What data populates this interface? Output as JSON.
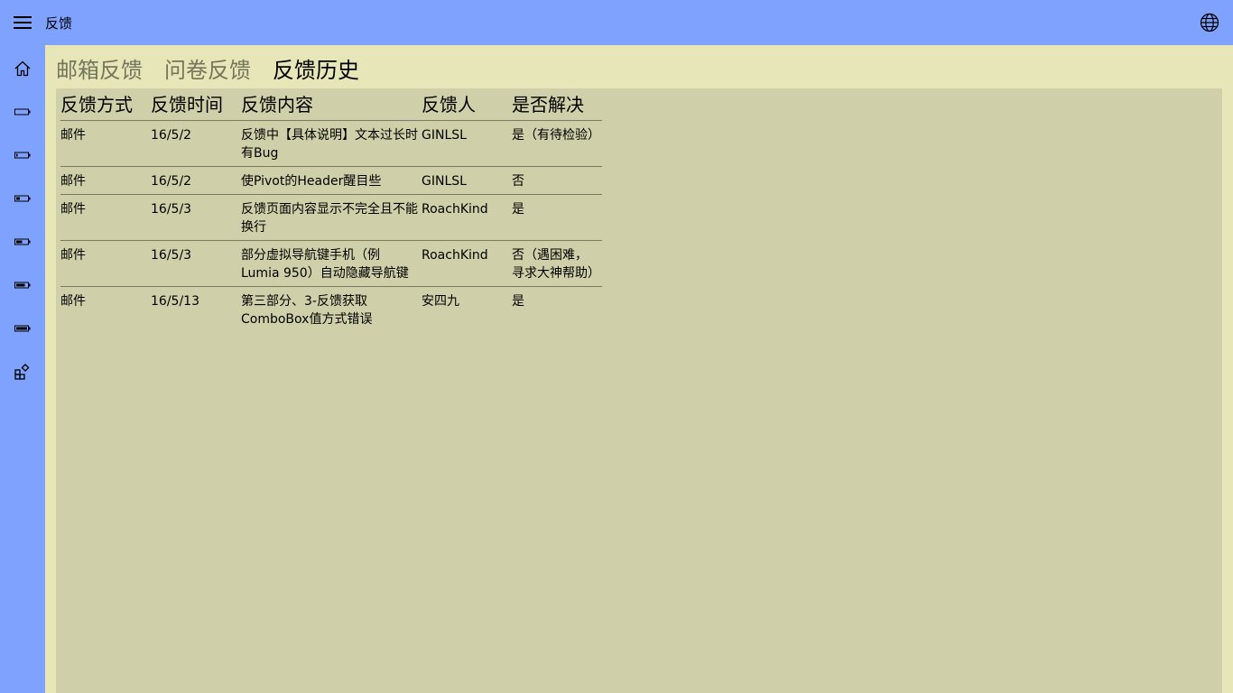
{
  "app": {
    "title": "反馈"
  },
  "colors": {
    "accent": "#7ea2fe",
    "content_bg": "#e6e6b8",
    "panel_bg": "#cfcfa9"
  },
  "sidebar": {
    "items": [
      {
        "icon": "home-icon"
      },
      {
        "icon": "battery-empty-icon"
      },
      {
        "icon": "battery-low-icon"
      },
      {
        "icon": "battery-quarter-icon"
      },
      {
        "icon": "battery-half-icon"
      },
      {
        "icon": "battery-high-icon"
      },
      {
        "icon": "battery-full-icon"
      },
      {
        "icon": "apps-add-icon"
      }
    ]
  },
  "pivot": {
    "tabs": [
      {
        "label": "邮箱反馈"
      },
      {
        "label": "问卷反馈"
      },
      {
        "label": "反馈历史"
      }
    ],
    "selected": "反馈历史"
  },
  "table": {
    "headers": [
      "反馈方式",
      "反馈时间",
      "反馈内容",
      "反馈人",
      "是否解决"
    ],
    "rows": [
      [
        "邮件",
        "16/5/2",
        "反馈中【具体说明】文本过长时有Bug",
        "GINLSL",
        "是（有待检验）"
      ],
      [
        "邮件",
        "16/5/2",
        "使Pivot的Header醒目些",
        "GINLSL",
        "否"
      ],
      [
        "邮件",
        "16/5/3",
        "反馈页面内容显示不完全且不能换行",
        "RoachKind",
        "是"
      ],
      [
        "邮件",
        "16/5/3",
        "部分虚拟导航键手机（例Lumia 950）自动隐藏导航键",
        "RoachKind",
        "否（遇困难，寻求大神帮助）"
      ],
      [
        "邮件",
        "16/5/13",
        "第三部分、3-反馈获取ComboBox值方式错误",
        "安四九",
        "是"
      ]
    ]
  }
}
